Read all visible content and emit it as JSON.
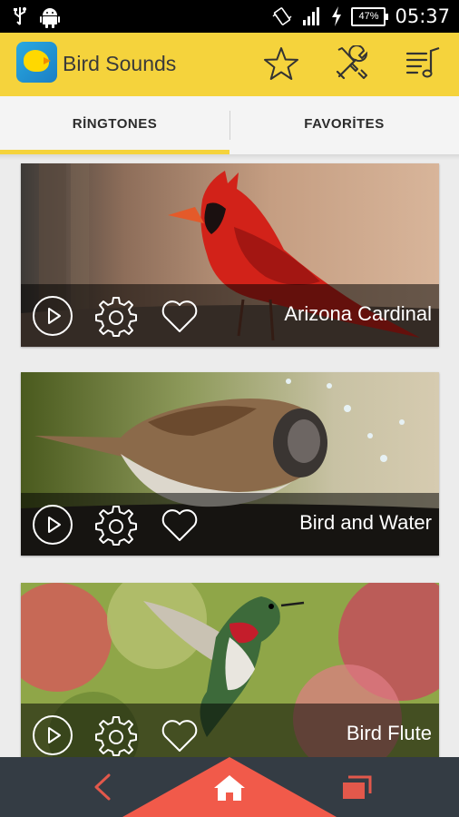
{
  "status_bar": {
    "battery": "47%",
    "time": "05:37",
    "icons": [
      "usb-icon",
      "android-icon",
      "vibrate-icon",
      "signal-icon",
      "charging-icon",
      "battery-icon"
    ]
  },
  "app_bar": {
    "title": "Bird Sounds",
    "actions": [
      "star-icon",
      "tools-icon",
      "playlist-icon"
    ]
  },
  "tabs": [
    {
      "label": "RİNGTONES",
      "active": true
    },
    {
      "label": "FAVORİTES",
      "active": false
    }
  ],
  "ringtones": [
    {
      "name": "Arizona Cardinal"
    },
    {
      "name": "Bird and Water"
    },
    {
      "name": "Bird Flute"
    }
  ],
  "bottom_nav": [
    "back-icon",
    "home-icon",
    "recent-apps-icon"
  ],
  "colors": {
    "accent": "#f5d33c",
    "nav_bg": "#343c44",
    "home_tab": "#f15a4a",
    "nav_icon": "#e2584b"
  }
}
